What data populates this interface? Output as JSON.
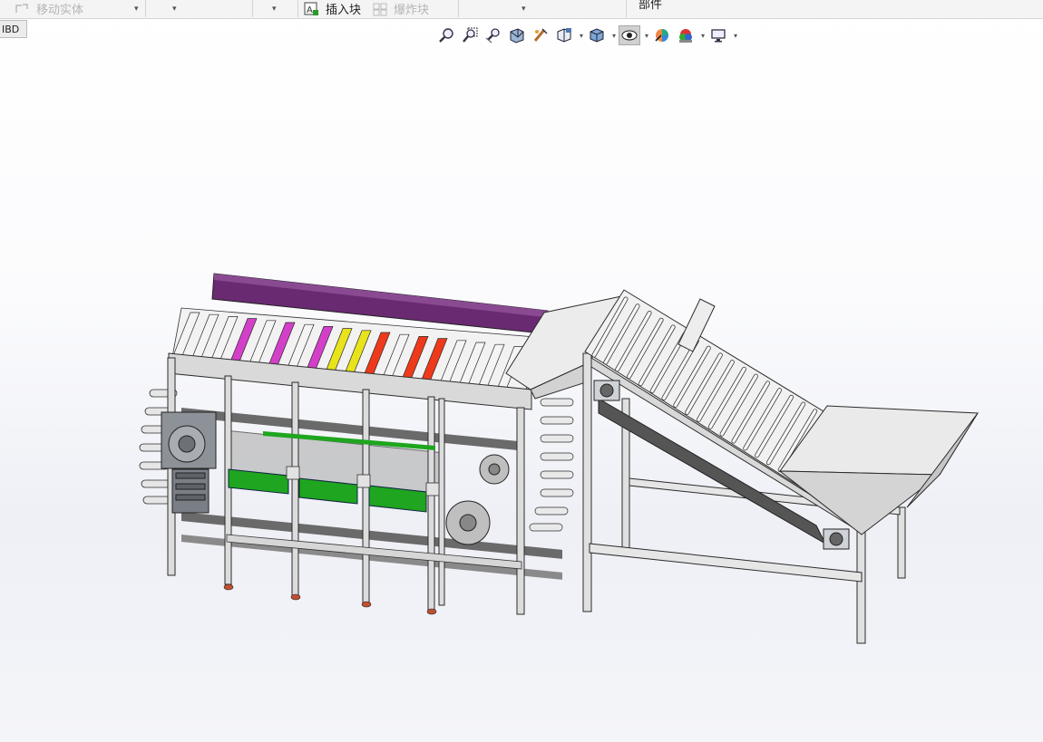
{
  "toolbar": {
    "move_body_label": "移动实体",
    "insert_block_label": "插入块",
    "explode_block_label": "爆炸块",
    "parts_label": "部件"
  },
  "tab": {
    "label": "IBD"
  },
  "view_toolbar": {
    "icons": [
      "zoom-to-fit-icon",
      "zoom-area-icon",
      "previous-view-icon",
      "section-view-icon",
      "dynamic-annotation-icon",
      "view-orientation-icon",
      "display-style-icon",
      "hide-show-items-icon",
      "edit-appearance-icon",
      "apply-scene-icon",
      "view-settings-icon"
    ]
  },
  "colors": {
    "frame": "#d9d9d9",
    "frame_edge": "#2b2b2b",
    "purple_bar": "#6a2a72",
    "green_block": "#1fa51f",
    "yellow_roller": "#e8e31a",
    "red_roller": "#ee3a1a",
    "magenta_roller": "#d43fc9",
    "motor": "#8d9298"
  }
}
